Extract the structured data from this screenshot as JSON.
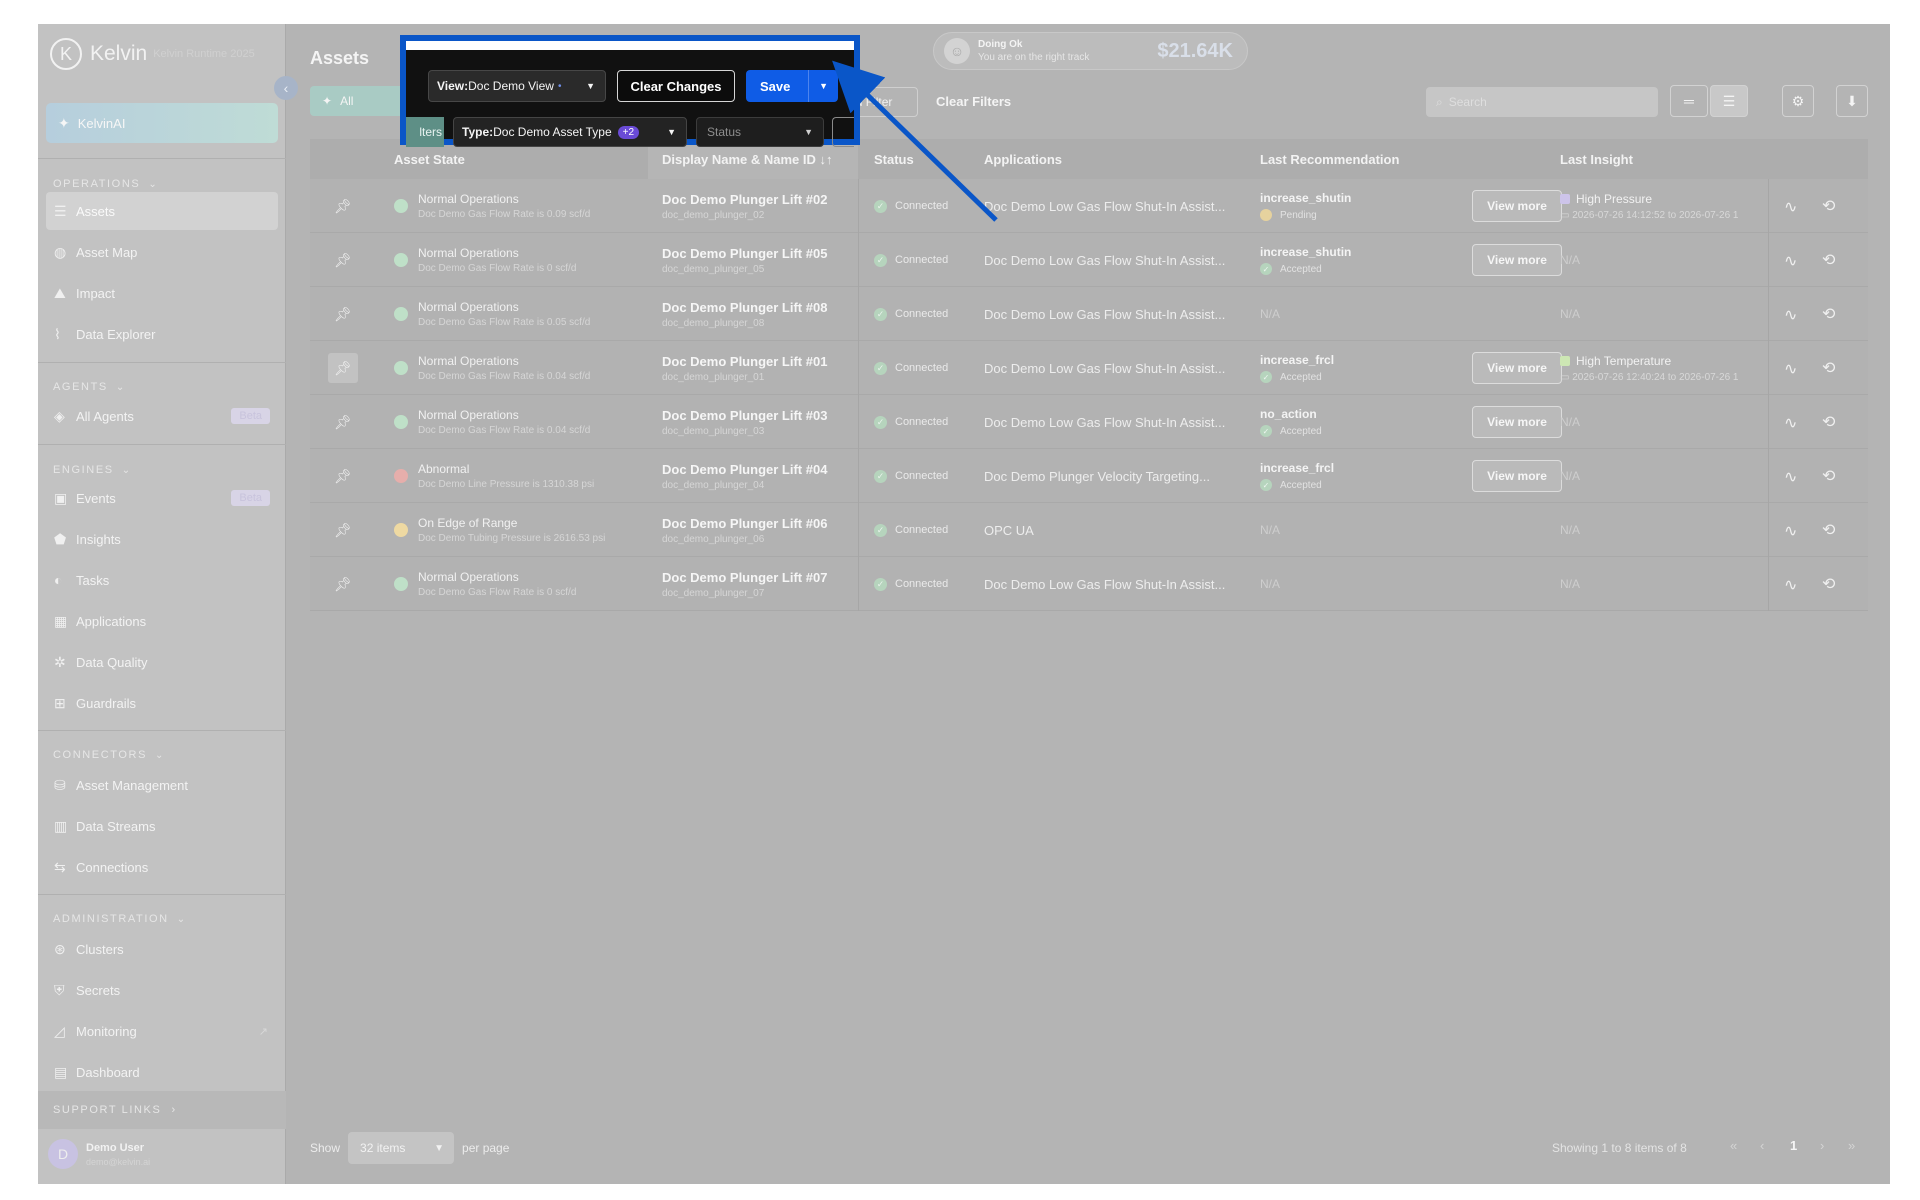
{
  "brand": {
    "name": "Kelvin",
    "sub": "Kelvin Runtime 2025"
  },
  "kelvinai": "KelvinAI",
  "sections": {
    "operations": "OPERATIONS",
    "agents": "AGENTS",
    "engines": "ENGINES",
    "connectors": "CONNECTORS",
    "administration": "ADMINISTRATION",
    "support": "SUPPORT LINKS"
  },
  "nav": {
    "assets": "Assets",
    "asset_map": "Asset Map",
    "impact": "Impact",
    "data_explorer": "Data Explorer",
    "all_agents": "All Agents",
    "events": "Events",
    "insights": "Insights",
    "tasks": "Tasks",
    "applications": "Applications",
    "data_quality": "Data Quality",
    "guardrails": "Guardrails",
    "asset_management": "Asset Management",
    "data_streams": "Data Streams",
    "connections": "Connections",
    "clusters": "Clusters",
    "secrets": "Secrets",
    "monitoring": "Monitoring",
    "dashboard": "Dashboard",
    "beta": "Beta"
  },
  "user": {
    "initial": "D",
    "name": "Demo User",
    "email": "demo@kelvin.ai"
  },
  "page_title": "Assets",
  "health": {
    "title": "Doing Ok",
    "subtitle": "You are on the right track",
    "amount": "$21.64K"
  },
  "toolbar": {
    "view_prefix": "View:",
    "view_value": "Doc Demo View",
    "modified_dot": "•",
    "clear_changes": "Clear Changes",
    "save": "Save",
    "all_filters_part": "lters",
    "type_prefix": "Type:",
    "type_value": "Doc Demo Asset Type",
    "type_count": "+2",
    "status_placeholder": "Status",
    "add_filter": "Add Filter",
    "clear_filters": "Clear Filters",
    "search_placeholder": "Search"
  },
  "columns": {
    "asset_state": "Asset State",
    "display_name": "Display Name & Name ID",
    "status": "Status",
    "applications": "Applications",
    "last_recommendation": "Last Recommendation",
    "last_insight": "Last Insight"
  },
  "rows": [
    {
      "state": "Normal Operations",
      "state_detail": "Doc Demo Gas Flow Rate is 0.09 scf/d",
      "name": "Doc Demo Plunger Lift #02",
      "id": "doc_demo_plunger_02",
      "status": "Connected",
      "app": "Doc Demo Low Gas Flow Shut-In Assist...",
      "rec": "increase_shutin",
      "rec_status": "Pending",
      "view_more": "View more",
      "insight": "High Pressure",
      "insight_time": "2026-07-26 14:12:52 to 2026-07-26 1"
    },
    {
      "state": "Normal Operations",
      "state_detail": "Doc Demo Gas Flow Rate is 0 scf/d",
      "name": "Doc Demo Plunger Lift #05",
      "id": "doc_demo_plunger_05",
      "status": "Connected",
      "app": "Doc Demo Low Gas Flow Shut-In Assist...",
      "rec": "increase_shutin",
      "rec_status": "Accepted",
      "view_more": "View more",
      "insight_na": "N/A"
    },
    {
      "state": "Normal Operations",
      "state_detail": "Doc Demo Gas Flow Rate is 0.05 scf/d",
      "name": "Doc Demo Plunger Lift #08",
      "id": "doc_demo_plunger_08",
      "status": "Connected",
      "app": "Doc Demo Low Gas Flow Shut-In Assist...",
      "rec_na": "N/A",
      "insight_na": "N/A"
    },
    {
      "state": "Normal Operations",
      "state_detail": "Doc Demo Gas Flow Rate is 0.04 scf/d",
      "name": "Doc Demo Plunger Lift #01",
      "id": "doc_demo_plunger_01",
      "status": "Connected",
      "app": "Doc Demo Low Gas Flow Shut-In Assist...",
      "rec": "increase_frcl",
      "rec_status": "Accepted",
      "view_more": "View more",
      "insight": "High Temperature",
      "insight_time": "2026-07-26 12:40:24 to 2026-07-26 1"
    },
    {
      "state": "Normal Operations",
      "state_detail": "Doc Demo Gas Flow Rate is 0.04 scf/d",
      "name": "Doc Demo Plunger Lift #03",
      "id": "doc_demo_plunger_03",
      "status": "Connected",
      "app": "Doc Demo Low Gas Flow Shut-In Assist...",
      "rec": "no_action",
      "rec_status": "Accepted",
      "view_more": "View more",
      "insight_na": "N/A"
    },
    {
      "state": "Abnormal",
      "state_detail": "Doc Demo Line Pressure is 1310.38 psi",
      "name": "Doc Demo Plunger Lift #04",
      "id": "doc_demo_plunger_04",
      "status": "Connected",
      "app": "Doc Demo Plunger Velocity Targeting...",
      "rec": "increase_frcl",
      "rec_status": "Accepted",
      "view_more": "View more",
      "insight_na": "N/A"
    },
    {
      "state": "On Edge of Range",
      "state_detail": "Doc Demo Tubing Pressure is 2616.53 psi",
      "name": "Doc Demo Plunger Lift #06",
      "id": "doc_demo_plunger_06",
      "status": "Connected",
      "app": "OPC UA",
      "rec_na": "N/A",
      "insight_na": "N/A"
    },
    {
      "state": "Normal Operations",
      "state_detail": "Doc Demo Gas Flow Rate is 0 scf/d",
      "name": "Doc Demo Plunger Lift #07",
      "id": "doc_demo_plunger_07",
      "status": "Connected",
      "app": "Doc Demo Low Gas Flow Shut-In Assist...",
      "rec_na": "N/A",
      "insight_na": "N/A"
    }
  ],
  "pagination": {
    "show": "Show",
    "per_page_value": "32 items",
    "per_page": "per page",
    "showing": "Showing 1 to 8 items of 8",
    "current_page": "1"
  },
  "colors": {
    "normal": "#bfe0c8",
    "abnormal": "#e6aeab",
    "edge": "#eed9a2",
    "insight_purple": "#cdc4ea",
    "insight_green": "#cde7b4",
    "highlight": "#0a56c8"
  }
}
